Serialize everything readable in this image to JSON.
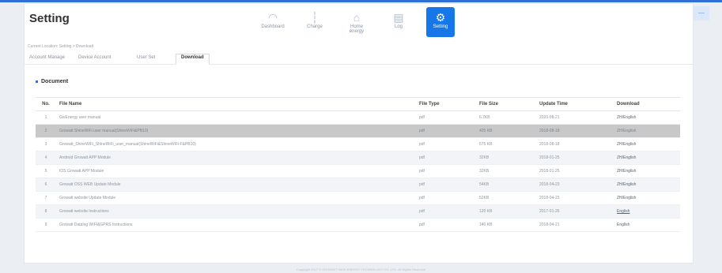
{
  "header": {
    "title": "Setting"
  },
  "nav": [
    {
      "icon": "gauge-icon",
      "glyph": "◠",
      "label": "Dashboard",
      "active": false
    },
    {
      "icon": "bar-chart-icon",
      "glyph": "┆",
      "label": "Charge",
      "active": false
    },
    {
      "icon": "home-icon",
      "glyph": "⌂",
      "label": "Home energy",
      "active": false
    },
    {
      "icon": "log-icon",
      "glyph": "▤",
      "label": "Log",
      "active": false
    },
    {
      "icon": "gear-icon",
      "glyph": "⚙",
      "label": "Setting",
      "active": true
    }
  ],
  "breadcrumb": "Current Location: Setting > Download",
  "tabs": [
    {
      "label": "Account Manage",
      "active": false
    },
    {
      "label": "Device Account",
      "active": false
    },
    {
      "label": "User Set",
      "active": false
    },
    {
      "label": "Download",
      "active": true
    }
  ],
  "section": {
    "title": "Document"
  },
  "table": {
    "headers": [
      "No.",
      "File Name",
      "File Type",
      "File Size",
      "Update Time",
      "Download"
    ],
    "rows": [
      {
        "no": "1",
        "name": "GivEnergy user manual",
        "type": "pdf",
        "size": "6.7KB",
        "time": "2020-08-21",
        "download": "ZH/English"
      },
      {
        "no": "2",
        "name": "Growatt ShineWiFi user manual(ShineWiFi&PB10)",
        "type": "pdf",
        "size": "425 KB",
        "time": "2018-08-18",
        "download": "ZH/English"
      },
      {
        "no": "3",
        "name": "Growatt_ShineWiFi_ShineWiFi_user_manual(ShineWiFi&ShineWiFi-F&PB10)",
        "type": "pdf",
        "size": "575 KB",
        "time": "2018-08-18",
        "download": "ZH/English"
      },
      {
        "no": "4",
        "name": "Android Growatt APP Module",
        "type": "pdf",
        "size": "32KB",
        "time": "2018-01-25",
        "download": "ZH/English"
      },
      {
        "no": "5",
        "name": "IOS Growatt APP Module",
        "type": "pdf",
        "size": "32KB",
        "time": "2018-01-25",
        "download": "ZH/English"
      },
      {
        "no": "6",
        "name": "Growatt OSS WEB Update Module",
        "type": "pdf",
        "size": "54KB",
        "time": "2018-04-23",
        "download": "ZH/English"
      },
      {
        "no": "7",
        "name": "Growatt website Update Module",
        "type": "pdf",
        "size": "52KB",
        "time": "2018-04-23",
        "download": "ZH/English"
      },
      {
        "no": "8",
        "name": "Growatt website Instructions",
        "type": "pdf",
        "size": "120 KB",
        "time": "2017-01-26",
        "download": "English"
      },
      {
        "no": "9",
        "name": "Growatt Datalog WIFI&GPRS Instructions",
        "type": "pdf",
        "size": "140 KB",
        "time": "2018-04-21",
        "download": "English"
      }
    ]
  },
  "footer": "Copyright 2017 © GROWATT NEW ENERGY TECHNOLOGY CO.,LTD. All Rights Reserved",
  "colors": {
    "accent": "#1677e8",
    "selected_row": "#c8c8c8"
  }
}
